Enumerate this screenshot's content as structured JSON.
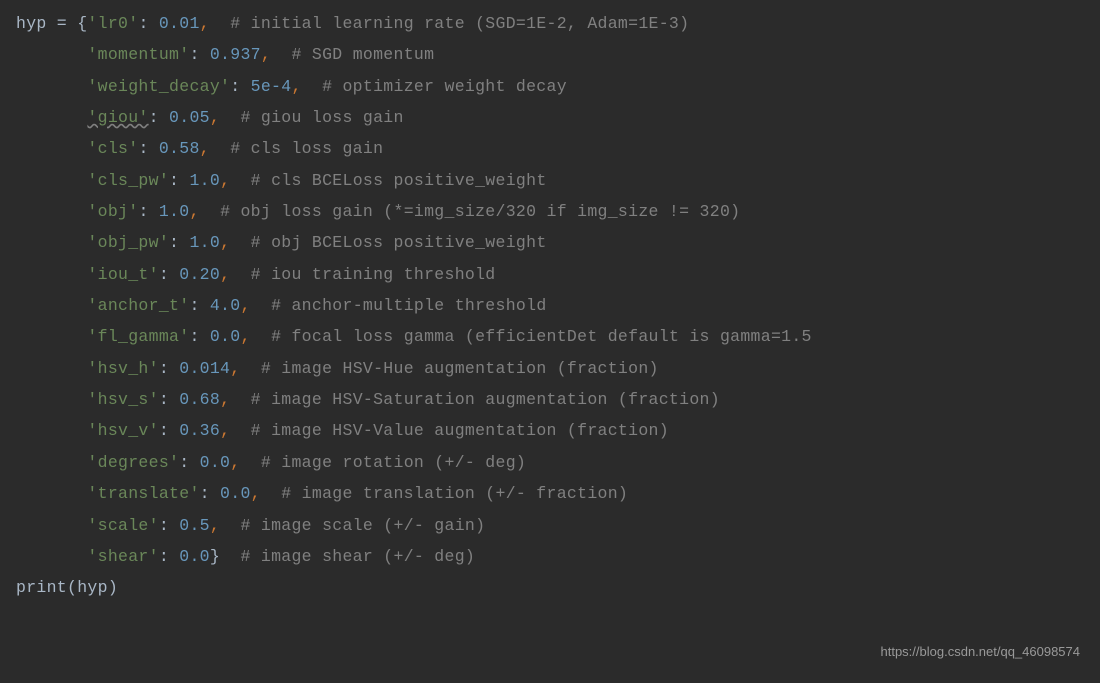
{
  "code": {
    "var_name": "hyp",
    "entries": [
      {
        "key": "'lr0'",
        "val": "0.01",
        "warn": false,
        "comment": "# initial learning rate (SGD=1E-2, Adam=1E-3)"
      },
      {
        "key": "'momentum'",
        "val": "0.937",
        "warn": false,
        "comment": "# SGD momentum"
      },
      {
        "key": "'weight_decay'",
        "val": "5e-4",
        "warn": false,
        "comment": "# optimizer weight decay"
      },
      {
        "key": "'giou'",
        "val": "0.05",
        "warn": true,
        "comment": "# giou loss gain"
      },
      {
        "key": "'cls'",
        "val": "0.58",
        "warn": false,
        "comment": "# cls loss gain"
      },
      {
        "key": "'cls_pw'",
        "val": "1.0",
        "warn": false,
        "comment": "# cls BCELoss positive_weight"
      },
      {
        "key": "'obj'",
        "val": "1.0",
        "warn": false,
        "comment": "# obj loss gain (*=img_size/320 if img_size != 320)"
      },
      {
        "key": "'obj_pw'",
        "val": "1.0",
        "warn": false,
        "comment": "# obj BCELoss positive_weight"
      },
      {
        "key": "'iou_t'",
        "val": "0.20",
        "warn": false,
        "comment": "# iou training threshold"
      },
      {
        "key": "'anchor_t'",
        "val": "4.0",
        "warn": false,
        "comment": "# anchor-multiple threshold"
      },
      {
        "key": "'fl_gamma'",
        "val": "0.0",
        "warn": false,
        "comment": "# focal loss gamma (efficientDet default is gamma=1.5"
      },
      {
        "key": "'hsv_h'",
        "val": "0.014",
        "warn": false,
        "comment": "# image HSV-Hue augmentation (fraction)"
      },
      {
        "key": "'hsv_s'",
        "val": "0.68",
        "warn": false,
        "comment": "# image HSV-Saturation augmentation (fraction)"
      },
      {
        "key": "'hsv_v'",
        "val": "0.36",
        "warn": false,
        "comment": "# image HSV-Value augmentation (fraction)"
      },
      {
        "key": "'degrees'",
        "val": "0.0",
        "warn": false,
        "comment": "# image rotation (+/- deg)"
      },
      {
        "key": "'translate'",
        "val": "0.0",
        "warn": false,
        "comment": "# image translation (+/- fraction)"
      },
      {
        "key": "'scale'",
        "val": "0.5",
        "warn": false,
        "comment": "# image scale (+/- gain)"
      },
      {
        "key": "'shear'",
        "val": "0.0",
        "warn": false,
        "comment": "# image shear (+/- deg)"
      }
    ],
    "print_call": "print",
    "print_arg": "hyp"
  },
  "watermark": "https://blog.csdn.net/qq_46098574"
}
